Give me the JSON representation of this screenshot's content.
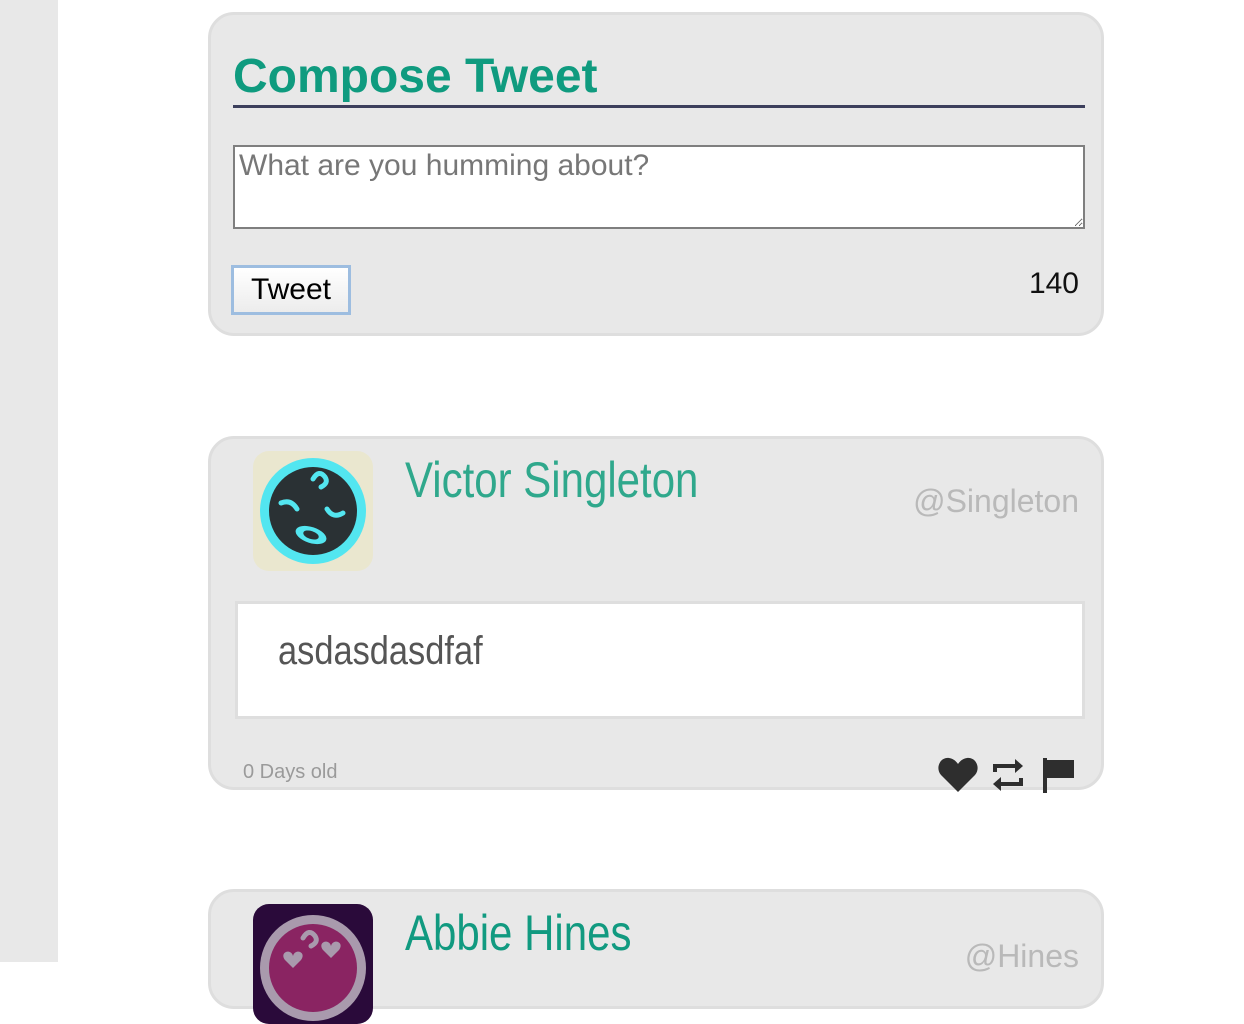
{
  "compose": {
    "title": "Compose Tweet",
    "placeholder": "What are you humming about?",
    "value": "",
    "button_label": "Tweet",
    "char_count": "140"
  },
  "tweets": [
    {
      "author_name": "Victor Singleton",
      "handle": "@Singleton",
      "text": "asdasdasdfaf",
      "age": "0 Days old",
      "avatar_icon": "astronaut-face-icon",
      "actions": [
        "heart-icon",
        "retweet-icon",
        "flag-icon"
      ]
    },
    {
      "author_name": "Abbie Hines",
      "handle": "@Hines",
      "avatar_icon": "astronaut-hearts-icon"
    }
  ],
  "colors": {
    "title": "#0f9b7f",
    "author_name": "#2fa88c",
    "panel": "#e8e8e8",
    "avatar1_bg": "#eae7cf",
    "avatar1_ring": "#53e6f0",
    "avatar2_bg": "#2a0a3a",
    "avatar2_ring": "#a99aad"
  }
}
